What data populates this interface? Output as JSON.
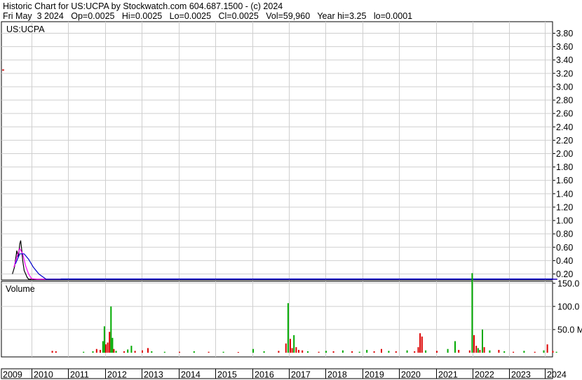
{
  "header": {
    "line1": "Historic Chart for US:UCPA by Stockwatch.com 604.687.1500 - (c) 2024",
    "line2": "Fri May  3 2024   Op=0.0025   Hi=0.0025   Lo=0.0025   Cl=0.0025   Vol=59,960   Year hi=3.25   lo=0.0001"
  },
  "colors": {
    "grid": "#cfcfcf",
    "axis": "#000000",
    "price": "#000000",
    "ma_short": "#ff00ff",
    "ma_long": "#0000cc",
    "vol_up": "#00aa00",
    "vol_down": "#dd0000"
  },
  "chart_data": [
    {
      "type": "line",
      "symbol_label": "US:UCPA",
      "ylim": [
        0,
        4.0
      ],
      "y_ticks": [
        "0.20",
        "0.40",
        "0.60",
        "0.80",
        "1.00",
        "1.20",
        "1.40",
        "1.60",
        "1.80",
        "2.00",
        "2.20",
        "2.40",
        "2.60",
        "2.80",
        "3.00",
        "3.20",
        "3.40",
        "3.60",
        "3.80"
      ],
      "y_tick_values": [
        0.2,
        0.4,
        0.6,
        0.8,
        1.0,
        1.2,
        1.4,
        1.6,
        1.8,
        2.0,
        2.2,
        2.4,
        2.6,
        2.8,
        3.0,
        3.2,
        3.4,
        3.6,
        3.8
      ],
      "x_ticks": [
        "2009",
        "2010",
        "2011",
        "2012",
        "2013",
        "2014",
        "2015",
        "2016",
        "2017",
        "2018",
        "2019",
        "2020",
        "2021",
        "2022",
        "2023",
        "2024"
      ],
      "x_tick_values": [
        2009.0,
        2010.0,
        2011.0,
        2012.0,
        2013.0,
        2014.0,
        2015.0,
        2016.0,
        2017.0,
        2018.0,
        2019.0,
        2020.0,
        2021.0,
        2022.0,
        2023.0,
        2024.0
      ],
      "xlim": [
        2009.0,
        2024.35
      ],
      "series": [
        {
          "role": "price",
          "x": [
            2009.0,
            2009.35,
            2009.42,
            2009.5,
            2009.55,
            2009.6,
            2009.63,
            2009.67,
            2009.7,
            2009.75,
            2009.8,
            2009.85,
            2009.9,
            2009.95,
            2010.0,
            2010.1,
            2010.2,
            2010.35,
            2010.5,
            2010.7,
            2011.0,
            2012.0,
            2014.0,
            2016.0,
            2017.0,
            2018.0,
            2019.0,
            2019.3,
            2020.0,
            2021.0,
            2021.7,
            2022.0,
            2023.0,
            2024.34
          ],
          "y": [
            3.25,
            0.2,
            0.3,
            0.55,
            0.45,
            0.65,
            0.7,
            0.55,
            0.4,
            0.25,
            0.2,
            0.15,
            0.12,
            0.1,
            0.08,
            0.07,
            0.05,
            0.04,
            0.03,
            0.02,
            0.015,
            0.01,
            0.008,
            0.008,
            0.012,
            0.01,
            0.015,
            0.02,
            0.01,
            0.012,
            0.02,
            0.012,
            0.005,
            0.0025
          ]
        },
        {
          "role": "ma_short",
          "x": [
            2009.4,
            2009.5,
            2009.6,
            2009.7,
            2009.8,
            2009.9,
            2010.0,
            2010.15,
            2010.3,
            2010.5,
            2010.7,
            2011.0,
            2024.34
          ],
          "y": [
            0.3,
            0.45,
            0.58,
            0.5,
            0.32,
            0.2,
            0.13,
            0.09,
            0.06,
            0.04,
            0.025,
            0.015,
            0.005
          ]
        },
        {
          "role": "ma_long",
          "x": [
            2009.45,
            2009.6,
            2009.75,
            2009.9,
            2010.05,
            2010.2,
            2010.4,
            2010.6,
            2010.8,
            2011.0,
            2011.5,
            2024.34
          ],
          "y": [
            0.35,
            0.5,
            0.5,
            0.42,
            0.3,
            0.2,
            0.12,
            0.07,
            0.04,
            0.025,
            0.015,
            0.008
          ]
        }
      ]
    },
    {
      "type": "bar",
      "title": "Volume",
      "ylim": [
        0,
        200000000
      ],
      "y_ticks": [
        "50.0 M",
        "100.0",
        "150.0"
      ],
      "y_tick_values": [
        50000000,
        100000000,
        150000000
      ],
      "bars": [
        {
          "x": 2010.55,
          "v": 4000000,
          "c": "down"
        },
        {
          "x": 2010.65,
          "v": 3000000,
          "c": "down"
        },
        {
          "x": 2011.4,
          "v": 2000000,
          "c": "up"
        },
        {
          "x": 2011.65,
          "v": 3000000,
          "c": "up"
        },
        {
          "x": 2011.75,
          "v": 8000000,
          "c": "down"
        },
        {
          "x": 2011.85,
          "v": 6000000,
          "c": "down"
        },
        {
          "x": 2011.92,
          "v": 25000000,
          "c": "up"
        },
        {
          "x": 2011.96,
          "v": 57000000,
          "c": "up"
        },
        {
          "x": 2012.0,
          "v": 18000000,
          "c": "down"
        },
        {
          "x": 2012.05,
          "v": 22000000,
          "c": "down"
        },
        {
          "x": 2012.1,
          "v": 45000000,
          "c": "down"
        },
        {
          "x": 2012.14,
          "v": 100000000,
          "c": "up"
        },
        {
          "x": 2012.18,
          "v": 32000000,
          "c": "up"
        },
        {
          "x": 2012.22,
          "v": 8000000,
          "c": "down"
        },
        {
          "x": 2012.28,
          "v": 4000000,
          "c": "up"
        },
        {
          "x": 2012.5,
          "v": 3000000,
          "c": "down"
        },
        {
          "x": 2012.6,
          "v": 7000000,
          "c": "up"
        },
        {
          "x": 2012.7,
          "v": 15000000,
          "c": "up"
        },
        {
          "x": 2012.8,
          "v": 4000000,
          "c": "down"
        },
        {
          "x": 2013.0,
          "v": 5000000,
          "c": "down"
        },
        {
          "x": 2013.15,
          "v": 10000000,
          "c": "down"
        },
        {
          "x": 2013.25,
          "v": 3000000,
          "c": "up"
        },
        {
          "x": 2013.6,
          "v": 2000000,
          "c": "up"
        },
        {
          "x": 2014.0,
          "v": 2000000,
          "c": "down"
        },
        {
          "x": 2014.4,
          "v": 3000000,
          "c": "up"
        },
        {
          "x": 2014.8,
          "v": 2000000,
          "c": "down"
        },
        {
          "x": 2015.2,
          "v": 2000000,
          "c": "up"
        },
        {
          "x": 2015.6,
          "v": 1500000,
          "c": "down"
        },
        {
          "x": 2016.0,
          "v": 8000000,
          "c": "up"
        },
        {
          "x": 2016.3,
          "v": 3000000,
          "c": "up"
        },
        {
          "x": 2016.7,
          "v": 4000000,
          "c": "down"
        },
        {
          "x": 2016.9,
          "v": 20000000,
          "c": "down"
        },
        {
          "x": 2016.96,
          "v": 107000000,
          "c": "up"
        },
        {
          "x": 2017.02,
          "v": 30000000,
          "c": "down"
        },
        {
          "x": 2017.07,
          "v": 10000000,
          "c": "down"
        },
        {
          "x": 2017.12,
          "v": 38000000,
          "c": "up"
        },
        {
          "x": 2017.18,
          "v": 12000000,
          "c": "down"
        },
        {
          "x": 2017.25,
          "v": 6000000,
          "c": "down"
        },
        {
          "x": 2017.35,
          "v": 5000000,
          "c": "down"
        },
        {
          "x": 2017.5,
          "v": 3000000,
          "c": "up"
        },
        {
          "x": 2017.8,
          "v": 2000000,
          "c": "down"
        },
        {
          "x": 2018.0,
          "v": 4000000,
          "c": "up"
        },
        {
          "x": 2018.2,
          "v": 3000000,
          "c": "down"
        },
        {
          "x": 2018.45,
          "v": 5000000,
          "c": "up"
        },
        {
          "x": 2018.7,
          "v": 3000000,
          "c": "down"
        },
        {
          "x": 2018.9,
          "v": 2000000,
          "c": "up"
        },
        {
          "x": 2019.1,
          "v": 6000000,
          "c": "up"
        },
        {
          "x": 2019.3,
          "v": 3000000,
          "c": "down"
        },
        {
          "x": 2019.5,
          "v": 8000000,
          "c": "down"
        },
        {
          "x": 2019.7,
          "v": 4000000,
          "c": "up"
        },
        {
          "x": 2019.9,
          "v": 3000000,
          "c": "down"
        },
        {
          "x": 2020.2,
          "v": 5000000,
          "c": "up"
        },
        {
          "x": 2020.4,
          "v": 3000000,
          "c": "down"
        },
        {
          "x": 2020.5,
          "v": 12000000,
          "c": "down"
        },
        {
          "x": 2020.55,
          "v": 42000000,
          "c": "down"
        },
        {
          "x": 2020.6,
          "v": 35000000,
          "c": "down"
        },
        {
          "x": 2020.7,
          "v": 5000000,
          "c": "up"
        },
        {
          "x": 2021.0,
          "v": 4000000,
          "c": "down"
        },
        {
          "x": 2021.3,
          "v": 8000000,
          "c": "up"
        },
        {
          "x": 2021.5,
          "v": 25000000,
          "c": "up"
        },
        {
          "x": 2021.6,
          "v": 6000000,
          "c": "down"
        },
        {
          "x": 2021.9,
          "v": 5000000,
          "c": "down"
        },
        {
          "x": 2021.97,
          "v": 172000000,
          "c": "up"
        },
        {
          "x": 2022.02,
          "v": 38000000,
          "c": "down"
        },
        {
          "x": 2022.08,
          "v": 15000000,
          "c": "down"
        },
        {
          "x": 2022.13,
          "v": 10000000,
          "c": "up"
        },
        {
          "x": 2022.18,
          "v": 6000000,
          "c": "down"
        },
        {
          "x": 2022.25,
          "v": 50000000,
          "c": "up"
        },
        {
          "x": 2022.3,
          "v": 12000000,
          "c": "down"
        },
        {
          "x": 2022.45,
          "v": 5000000,
          "c": "up"
        },
        {
          "x": 2022.7,
          "v": 6000000,
          "c": "down"
        },
        {
          "x": 2022.85,
          "v": 3000000,
          "c": "up"
        },
        {
          "x": 2023.1,
          "v": 2000000,
          "c": "down"
        },
        {
          "x": 2023.4,
          "v": 4000000,
          "c": "up"
        },
        {
          "x": 2023.7,
          "v": 2000000,
          "c": "down"
        },
        {
          "x": 2023.95,
          "v": 5000000,
          "c": "up"
        },
        {
          "x": 2024.05,
          "v": 18000000,
          "c": "down"
        },
        {
          "x": 2024.2,
          "v": 4000000,
          "c": "down"
        },
        {
          "x": 2024.3,
          "v": 2000000,
          "c": "up"
        }
      ]
    }
  ]
}
